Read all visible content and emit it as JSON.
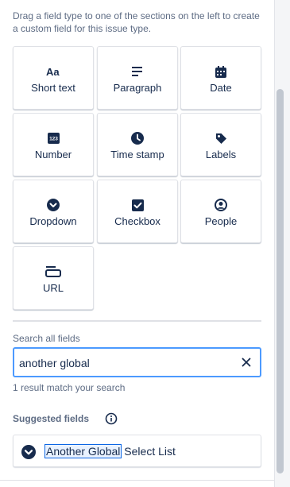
{
  "description": "Drag a field type to one of the sections on the left to create a custom field for this issue type.",
  "field_types": [
    {
      "label": "Short text",
      "icon": "short-text-icon"
    },
    {
      "label": "Paragraph",
      "icon": "paragraph-icon"
    },
    {
      "label": "Date",
      "icon": "calendar-icon"
    },
    {
      "label": "Number",
      "icon": "number-icon"
    },
    {
      "label": "Time stamp",
      "icon": "clock-icon"
    },
    {
      "label": "Labels",
      "icon": "tag-icon"
    },
    {
      "label": "Dropdown",
      "icon": "chevron-circle-icon"
    },
    {
      "label": "Checkbox",
      "icon": "checkbox-icon"
    },
    {
      "label": "People",
      "icon": "person-icon"
    },
    {
      "label": "URL",
      "icon": "link-icon"
    }
  ],
  "search": {
    "label": "Search all fields",
    "value": "another global",
    "result_text": "1 result match your search"
  },
  "suggested": {
    "heading": "Suggested fields",
    "items": [
      {
        "match": "Another Global",
        "rest": " Select List",
        "icon": "chevron-circle-icon"
      }
    ]
  },
  "colors": {
    "icon": "#172b4d",
    "focus_border": "#4c9aff",
    "highlight_bg": "#e9f2ff",
    "highlight_border": "#0c66e4"
  }
}
